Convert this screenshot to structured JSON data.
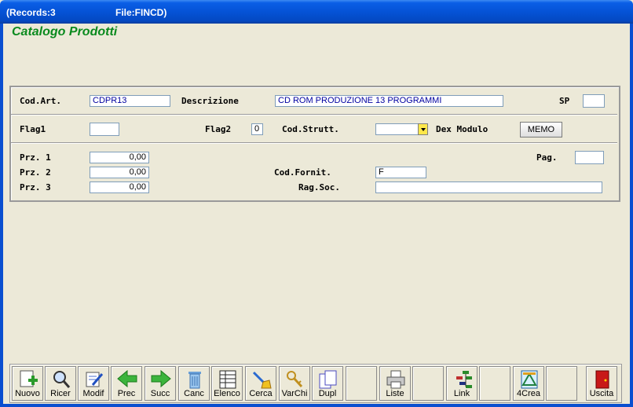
{
  "window": {
    "records": "(Records:3",
    "file": "File:FINCD)"
  },
  "app_title": "Catalogo Prodotti",
  "form": {
    "cod_art_label": "Cod.Art.",
    "cod_art_value": "CDPR13",
    "descrizione_label": "Descrizione",
    "descrizione_value": "CD ROM PRODUZIONE 13 PROGRAMMI",
    "sp_label": "SP",
    "sp_value": "",
    "flag1_label": "Flag1",
    "flag1_value": "",
    "flag2_label": "Flag2",
    "flag2_value": "0",
    "cod_strutt_label": "Cod.Strutt.",
    "cod_strutt_value": "",
    "dex_modulo_label": "Dex Modulo",
    "memo_label": "MEMO",
    "prz1_label": "Prz. 1",
    "prz1_value": "0,00",
    "prz2_label": "Prz. 2",
    "prz2_value": "0,00",
    "prz3_label": "Prz. 3",
    "prz3_value": "0,00",
    "pag_label": "Pag.",
    "pag_value": "",
    "cod_fornit_label": "Cod.Fornit.",
    "cod_fornit_value": "F",
    "rag_soc_label": "Rag.Soc.",
    "rag_soc_value": ""
  },
  "toolbar": {
    "nuovo": "Nuovo",
    "ricer": "Ricer",
    "modif": "Modif",
    "prec": "Prec",
    "succ": "Succ",
    "canc": "Canc",
    "elenco": "Elenco",
    "cerca": "Cerca",
    "varchi": "VarChi",
    "dupl": "Dupl",
    "liste": "Liste",
    "link": "Link",
    "crea4": "4Crea",
    "uscita": "Uscita"
  },
  "colors": {
    "title_green": "#0a8a1e",
    "titlebar_blue": "#0553d6",
    "value_blue": "#0000a0",
    "combo_yellow": "#ffe84a"
  },
  "icons": [
    "new-document-icon",
    "search-icon",
    "edit-icon",
    "arrow-left-icon",
    "arrow-right-icon",
    "trash-icon",
    "list-icon",
    "find-icon",
    "keys-icon",
    "duplicate-icon",
    "printer-icon",
    "tree-icon",
    "crea-icon",
    "exit-door-icon"
  ]
}
